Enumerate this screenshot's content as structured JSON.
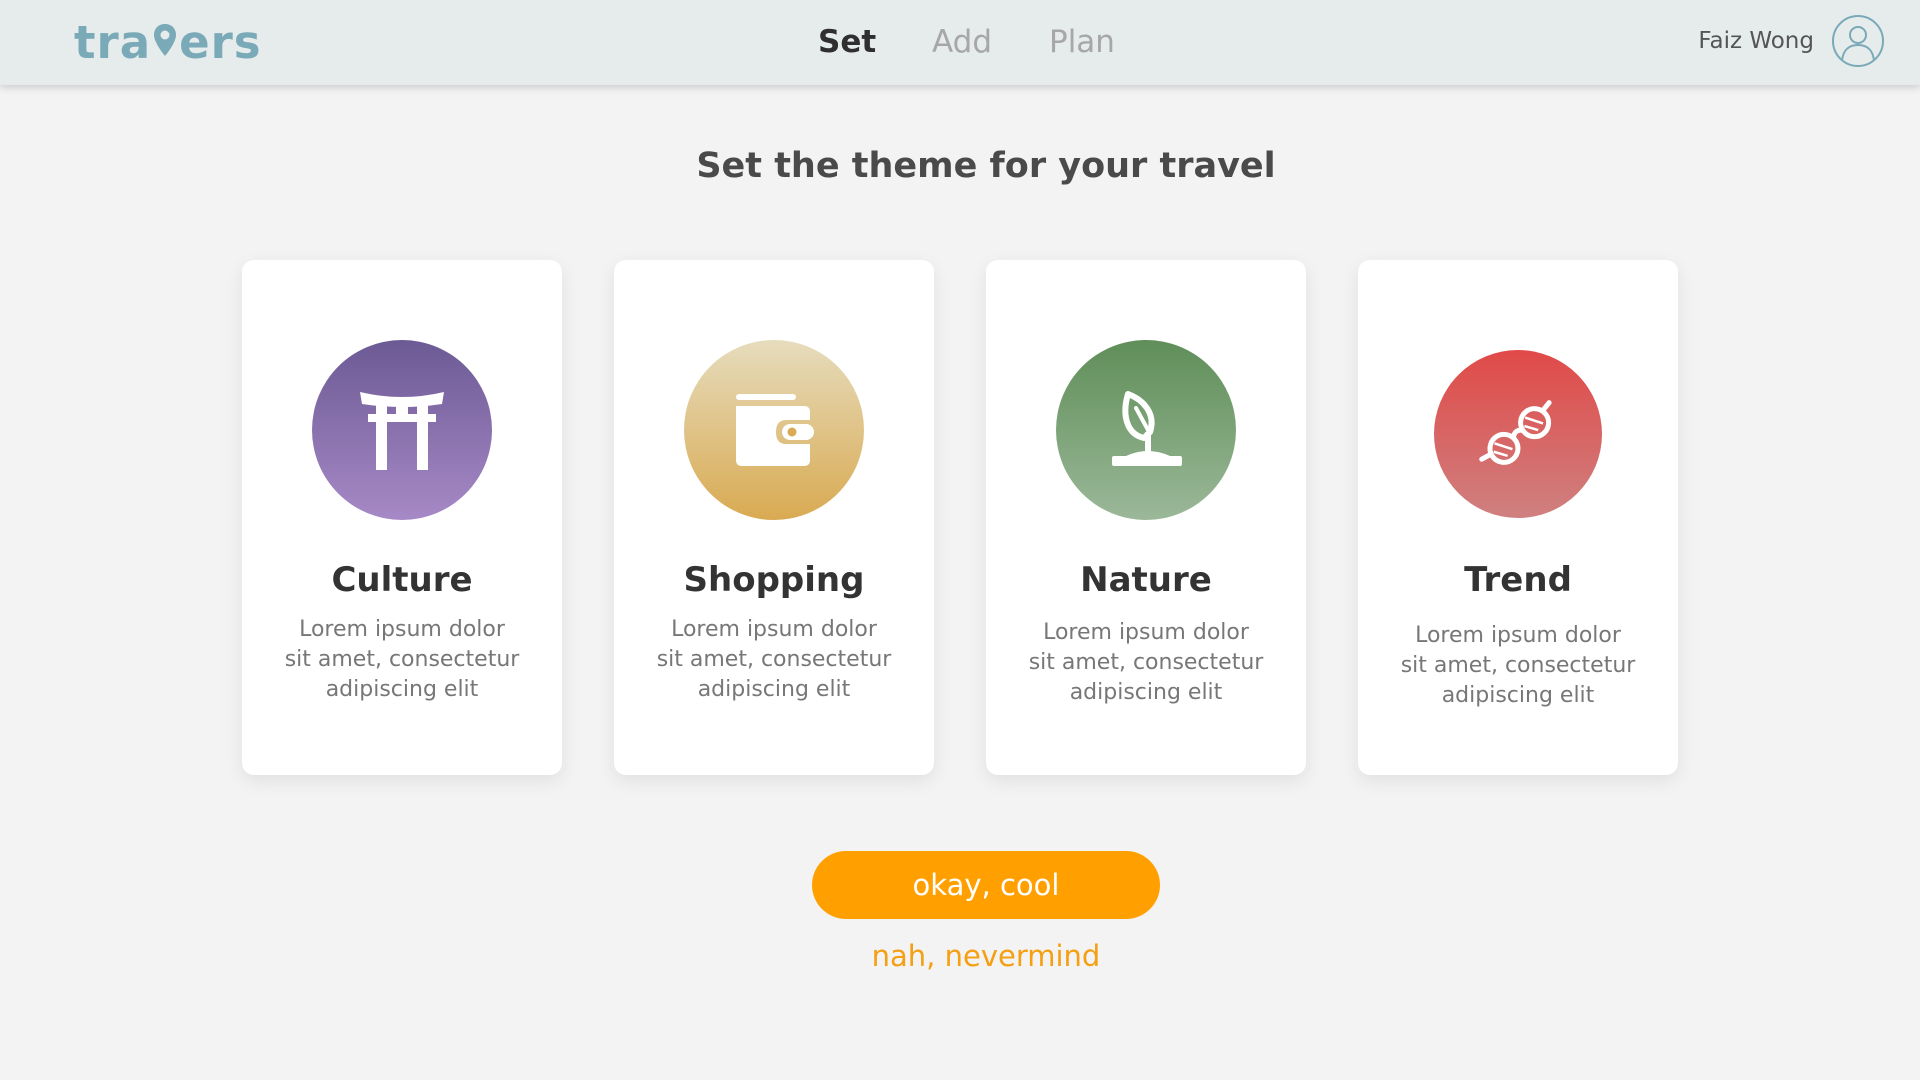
{
  "header": {
    "logo_left": "tra",
    "logo_right": "ers",
    "nav": [
      {
        "label": "Set",
        "active": true
      },
      {
        "label": "Add",
        "active": false
      },
      {
        "label": "Plan",
        "active": false
      }
    ],
    "user_name": "Faiz Wong"
  },
  "main": {
    "title": "Set the theme for your travel",
    "themes": [
      {
        "name": "Culture",
        "icon": "torii-gate-icon",
        "color_top": "#6c5a94",
        "color_bottom": "#a689c6",
        "desc": [
          "Lorem ipsum dolor",
          "sit amet, consectetur",
          "adipiscing elit"
        ]
      },
      {
        "name": "Shopping",
        "icon": "wallet-icon",
        "color_top": "#e6dcbd",
        "color_bottom": "#d9aa52",
        "desc": [
          "Lorem ipsum dolor",
          "sit amet, consectetur",
          "adipiscing elit"
        ]
      },
      {
        "name": "Nature",
        "icon": "sprout-icon",
        "color_top": "#5f8e58",
        "color_bottom": "#9bb899",
        "desc": [
          "Lorem ipsum dolor",
          "sit amet, consectetur",
          "adipiscing elit"
        ]
      },
      {
        "name": "Trend",
        "icon": "sunglasses-icon",
        "color_top": "#e04a48",
        "color_bottom": "#cf8080",
        "desc": [
          "Lorem ipsum dolor",
          "sit amet, consectetur",
          "adipiscing elit"
        ]
      }
    ]
  },
  "actions": {
    "confirm_label": "okay, cool",
    "cancel_label": "nah, nevermind",
    "accent_color": "#ffa000"
  }
}
